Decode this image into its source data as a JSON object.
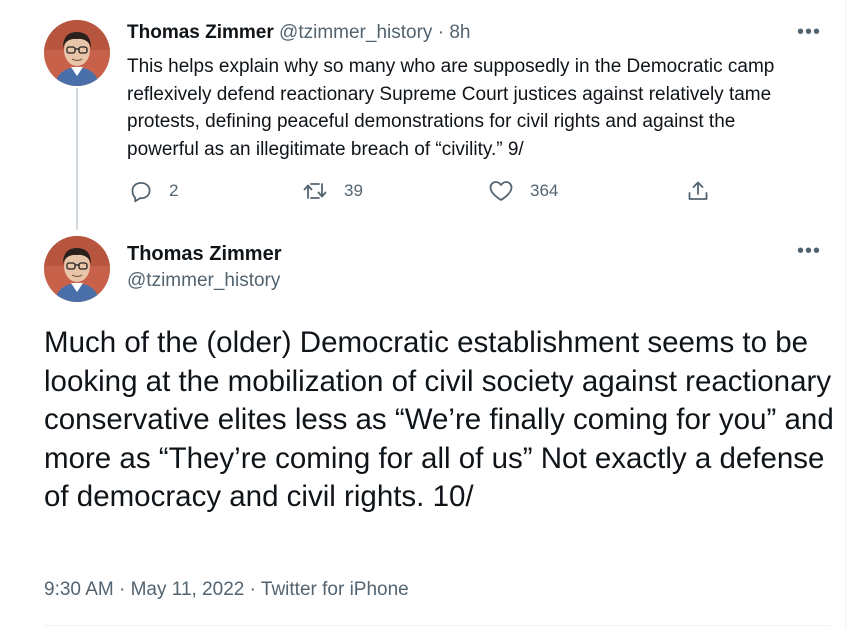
{
  "tweet1": {
    "author_name": "Thomas Zimmer",
    "author_handle": "@tzimmer_history",
    "separator": "·",
    "time": "8h",
    "text": "This helps explain why so many who are supposedly in the Democratic camp reflexively defend reactionary Supreme Court justices against relatively tame protests, defining peaceful demonstrations for civil rights and against the powerful as an illegitimate breach of “civility.” 9/",
    "replies": "2",
    "retweets": "39",
    "likes": "364",
    "more_label": "•••"
  },
  "tweet2": {
    "author_name": "Thomas Zimmer",
    "author_handle": "@tzimmer_history",
    "text": "Much of the (older) Democratic establishment seems to be looking at the mobilization of civil society against reactionary conservative elites less as “We’re finally coming for you” and more as “They’re coming for all of us” Not exactly a defense of democracy and civil rights. 10/",
    "time": "9:30 AM",
    "date": "May 11, 2022",
    "source": "Twitter for iPhone",
    "separator": "·",
    "more_label": "•••"
  },
  "icons": {
    "reply": "reply-icon",
    "retweet": "retweet-icon",
    "like": "heart-icon",
    "share": "share-icon",
    "more": "more-icon"
  },
  "colors": {
    "text": "#0f1419",
    "muted": "#536471",
    "thread_line": "#cfd9de",
    "avatar_bg": "#c8614a"
  }
}
